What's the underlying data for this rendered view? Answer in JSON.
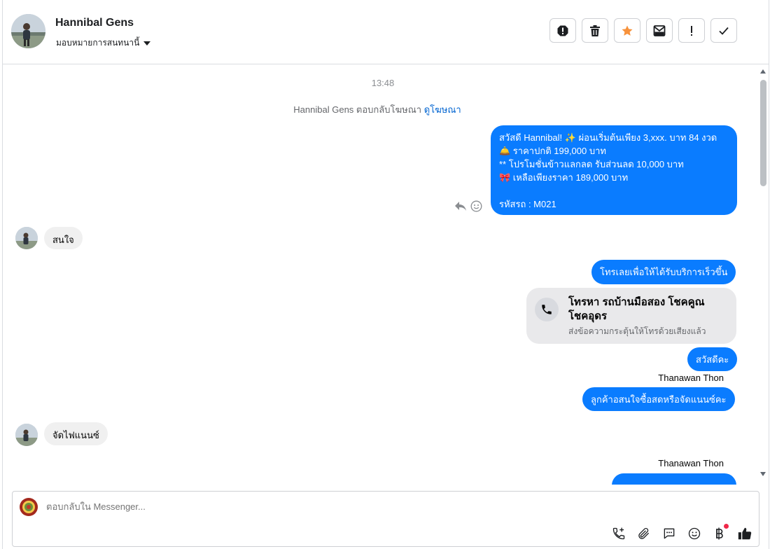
{
  "header": {
    "contact_name": "Hannibal Gens",
    "assign_label": "มอบหมายการสนทนานี้"
  },
  "actions": [
    {
      "icon": "spam-icon"
    },
    {
      "icon": "trash-icon"
    },
    {
      "icon": "star-icon"
    },
    {
      "icon": "mark-unread-icon"
    },
    {
      "icon": "follow-up-icon"
    },
    {
      "icon": "check-icon"
    }
  ],
  "conversation": {
    "timestamp": "13:48",
    "ad_reply_text": "Hannibal Gens ตอบกลับโฆษณา",
    "ad_link_text": "ดูโฆษณา",
    "first_message_lines": [
      "สวัสดี Hannibal! ✨  ผ่อนเริ่มต้นเพียง 3,xxx. บาท 84 งวด",
      "🛎️ ราคาปกติ 199,000 บาท",
      "** โปรโมชั่นข้าวแลกลด รับส่วนลด 10,000 บาท",
      "🎀  เหลือเพียงราคา 189,000 บาท",
      "",
      " รหัสรถ : M021"
    ],
    "incoming_1": "สนใจ",
    "outgoing_call_prompt": "โทรเลยเพื่อให้ได้รับบริการเร็วขึ้น",
    "call_card": {
      "title": "โทรหา รถบ้านมือสอง โชคคูณ โชคอุดร",
      "subtitle": "ส่งข้อความกระตุ้นให้โทรด้วยเสียงแล้ว"
    },
    "outgoing_greeting": "สวัสดีคะ",
    "sender_1": "Thanawan Thon",
    "outgoing_question": "ลูกค้าอสนใจซื้อสดหรือจัดแนนซ์คะ",
    "incoming_2": "จัดไฟแนนซ์",
    "sender_2": "Thanawan Thon"
  },
  "composer": {
    "placeholder": "ตอบกลับใน Messenger...",
    "tools": [
      "call-add-icon",
      "attach-icon",
      "saved-replies-icon",
      "emoji-icon",
      "baht-payment-icon",
      "like-icon"
    ]
  },
  "colors": {
    "outgoing_bubble": "#0a7cff",
    "incoming_bubble": "#f0f0f0",
    "star": "#f7923b",
    "link": "#0064d1"
  }
}
